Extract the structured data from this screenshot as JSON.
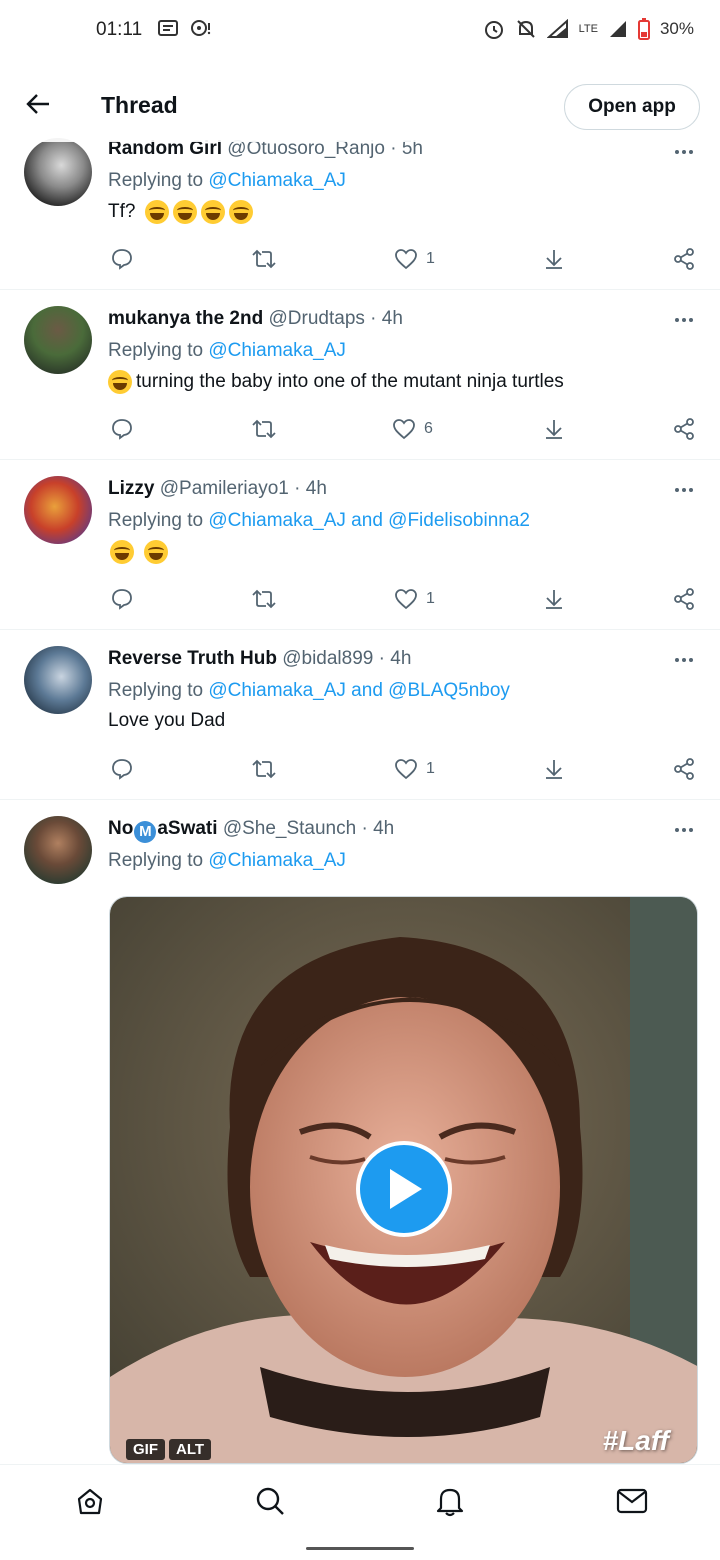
{
  "status_bar": {
    "time": "01:11",
    "network": "LTE",
    "battery": "30%"
  },
  "header": {
    "title": "Thread",
    "open_app_label": "Open app"
  },
  "tweets": [
    {
      "name": "Random Girl",
      "handle": "@Otuosoro_Ranjo",
      "time": "· 5h",
      "replying_prefix": "Replying to",
      "replying_to": "@Chiamaka_AJ",
      "text": "Tf?",
      "emoji_count": 4,
      "likes": "1"
    },
    {
      "name": "mukanya the 2nd",
      "handle": "@Drudtaps",
      "time": "· 4h",
      "replying_prefix": "Replying to",
      "replying_to": "@Chiamaka_AJ",
      "text": "turning the baby into one of the  mutant ninja turtles",
      "likes": "6"
    },
    {
      "name": "Lizzy",
      "handle": "@Pamileriayo1",
      "time": "· 4h",
      "replying_prefix": "Replying to",
      "replying_to": "@Chiamaka_AJ and @Fidelisobinna2",
      "likes": "1"
    },
    {
      "name": "Reverse Truth Hub",
      "handle": "@bidal899",
      "time": "· 4h",
      "replying_prefix": "Replying to",
      "replying_to": "@Chiamaka_AJ and @BLAQ5nboy",
      "text": "Love you Dad",
      "likes": "1"
    },
    {
      "name_part1": "No",
      "name_badge": "M",
      "name_part2": "aSwati",
      "handle": "@She_Staunch",
      "time": "· 4h",
      "replying_prefix": "Replying to",
      "replying_to": "@Chiamaka_AJ",
      "media": {
        "badge_gif": "GIF",
        "badge_alt": "ALT",
        "watermark": "#Laff"
      }
    }
  ],
  "colors": {
    "accent": "#1d9bf0",
    "text_primary": "#0f1419",
    "text_secondary": "#536471"
  }
}
